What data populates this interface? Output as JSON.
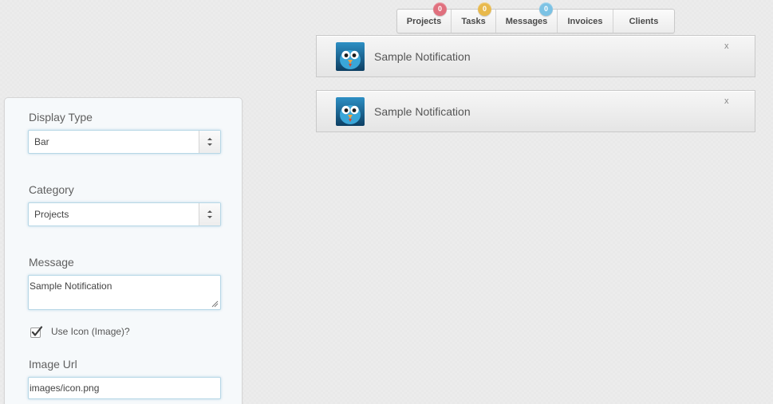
{
  "tabs": [
    {
      "label": "Projects",
      "badge": "0",
      "badge_color": "#e0707e"
    },
    {
      "label": "Tasks",
      "badge": "0",
      "badge_color": "#e8b94c"
    },
    {
      "label": "Messages",
      "badge": "0",
      "badge_color": "#7cc2e4"
    },
    {
      "label": "Invoices"
    },
    {
      "label": "Clients"
    }
  ],
  "notifications": [
    {
      "icon": "bird-avatar-icon",
      "text": "Sample Notification",
      "close": "x"
    },
    {
      "icon": "bird-avatar-icon",
      "text": "Sample Notification",
      "close": "x"
    }
  ],
  "form": {
    "display_type": {
      "label": "Display Type",
      "value": "Bar"
    },
    "category": {
      "label": "Category",
      "value": "Projects"
    },
    "message": {
      "label": "Message",
      "value": "Sample Notification"
    },
    "use_icon": {
      "label": "Use Icon (Image)?",
      "checked": true
    },
    "image_url": {
      "label": "Image Url",
      "value": "images/icon.png"
    }
  }
}
